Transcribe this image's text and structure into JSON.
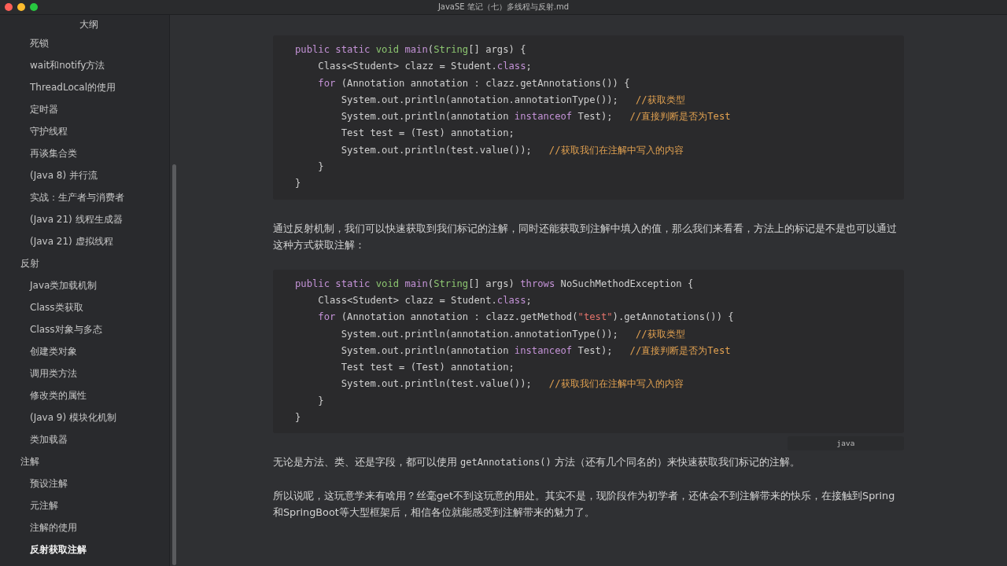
{
  "window": {
    "title": "JavaSE 笔记（七）多线程与反射.md"
  },
  "outline": {
    "title": "大纲",
    "items": [
      {
        "children": [
          {
            "label": "死锁",
            "selected": false
          },
          {
            "label": "wait和notify方法",
            "selected": false
          },
          {
            "label": "ThreadLocal的使用",
            "selected": false
          },
          {
            "label": "定时器",
            "selected": false
          },
          {
            "label": "守护线程",
            "selected": false
          },
          {
            "label": "再谈集合类",
            "selected": false
          },
          {
            "label": "(Java 8) 并行流",
            "selected": false
          },
          {
            "label": "实战：生产者与消费者",
            "selected": false
          },
          {
            "label": "(Java 21) 线程生成器",
            "selected": false
          },
          {
            "label": "(Java 21) 虚拟线程",
            "selected": false
          }
        ]
      },
      {
        "label": "反射",
        "selected": false,
        "children": [
          {
            "label": "Java类加载机制",
            "selected": false
          },
          {
            "label": "Class类获取",
            "selected": false
          },
          {
            "label": "Class对象与多态",
            "selected": false
          },
          {
            "label": "创建类对象",
            "selected": false
          },
          {
            "label": "调用类方法",
            "selected": false
          },
          {
            "label": "修改类的属性",
            "selected": false
          },
          {
            "label": "(Java 9) 模块化机制",
            "selected": false
          },
          {
            "label": "类加载器",
            "selected": false
          }
        ]
      },
      {
        "label": "注解",
        "selected": false,
        "children": [
          {
            "label": "预设注解",
            "selected": false
          },
          {
            "label": "元注解",
            "selected": false
          },
          {
            "label": "注解的使用",
            "selected": false
          },
          {
            "label": "反射获取注解",
            "selected": true
          }
        ]
      }
    ]
  },
  "content": [
    {
      "kind": "code",
      "lines": [
        [
          {
            "t": "public static ",
            "kind": "keyword"
          },
          {
            "t": "void ",
            "kind": "type"
          },
          {
            "t": "main",
            "kind": "def"
          },
          {
            "t": "(",
            "kind": "plain"
          },
          {
            "t": "String",
            "kind": "type"
          },
          {
            "t": "[] args) {",
            "kind": "plain"
          }
        ],
        [
          {
            "t": "    Class<Student> clazz = Student.",
            "kind": "plain"
          },
          {
            "t": "class",
            "kind": "keyword"
          },
          {
            "t": ";",
            "kind": "plain"
          }
        ],
        [
          {
            "t": "    for",
            "kind": "keyword"
          },
          {
            "t": " (Annotation annotation : clazz.getAnnotations()) {",
            "kind": "plain"
          }
        ],
        [
          {
            "t": "        System.out.println(annotation.annotationType());   ",
            "kind": "plain"
          },
          {
            "t": "//获取类型",
            "kind": "comment"
          }
        ],
        [
          {
            "t": "        System.out.println(annotation ",
            "kind": "plain"
          },
          {
            "t": "instanceof",
            "kind": "keyword"
          },
          {
            "t": " Test);   ",
            "kind": "plain"
          },
          {
            "t": "//直接判断是否为Test",
            "kind": "comment"
          }
        ],
        [
          {
            "t": "        Test test = (Test) annotation;",
            "kind": "plain"
          }
        ],
        [
          {
            "t": "        System.out.println(test.value());   ",
            "kind": "plain"
          },
          {
            "t": "//获取我们在注解中写入的内容",
            "kind": "comment"
          }
        ],
        [
          {
            "t": "    }",
            "kind": "plain"
          }
        ],
        [
          {
            "t": "}",
            "kind": "plain"
          }
        ]
      ]
    },
    {
      "kind": "text",
      "parts": [
        {
          "t": "通过反射机制，我们可以快速获取到我们标记的注解，同时还能获取到注解中填入的值，那么我们来看看，方法上的标记是不是也可以通过这种方式获取注解：",
          "kind": "plain"
        }
      ]
    },
    {
      "kind": "code",
      "lang": "java",
      "lines": [
        [
          {
            "t": "public static ",
            "kind": "keyword"
          },
          {
            "t": "void ",
            "kind": "type"
          },
          {
            "t": "main",
            "kind": "def"
          },
          {
            "t": "(",
            "kind": "plain"
          },
          {
            "t": "String",
            "kind": "type"
          },
          {
            "t": "[] args) ",
            "kind": "plain"
          },
          {
            "t": "throws",
            "kind": "keyword"
          },
          {
            "t": " NoSuchMethodException {",
            "kind": "plain"
          }
        ],
        [
          {
            "t": "    Class<Student> clazz = Student.",
            "kind": "plain"
          },
          {
            "t": "class",
            "kind": "keyword"
          },
          {
            "t": ";",
            "kind": "plain"
          }
        ],
        [
          {
            "t": "    for",
            "kind": "keyword"
          },
          {
            "t": " (Annotation annotation : clazz.getMethod(",
            "kind": "plain"
          },
          {
            "t": "\"test\"",
            "kind": "string"
          },
          {
            "t": ").getAnnotations()) {",
            "kind": "plain"
          }
        ],
        [
          {
            "t": "        System.out.println(annotation.annotationType());   ",
            "kind": "plain"
          },
          {
            "t": "//获取类型",
            "kind": "comment"
          }
        ],
        [
          {
            "t": "        System.out.println(annotation ",
            "kind": "plain"
          },
          {
            "t": "instanceof",
            "kind": "keyword"
          },
          {
            "t": " Test);   ",
            "kind": "plain"
          },
          {
            "t": "//直接判断是否为Test",
            "kind": "comment"
          }
        ],
        [
          {
            "t": "        Test test = (Test) annotation;",
            "kind": "plain"
          }
        ],
        [
          {
            "t": "        System.out.println(test.value());   ",
            "kind": "plain"
          },
          {
            "t": "//获取我们在注解中写入的内容",
            "kind": "comment"
          }
        ],
        [
          {
            "t": "    }",
            "kind": "plain"
          }
        ],
        [
          {
            "t": "}",
            "kind": "plain"
          }
        ]
      ]
    },
    {
      "kind": "text",
      "parts": [
        {
          "t": "无论是方法、类、还是字段，都可以使用 ",
          "kind": "plain"
        },
        {
          "t": "getAnnotations()",
          "kind": "code"
        },
        {
          "t": " 方法（还有几个同名的）来快速获取我们标记的注解。",
          "kind": "plain"
        }
      ]
    },
    {
      "kind": "text",
      "parts": [
        {
          "t": "所以说呢，这玩意学来有啥用？丝毫get不到这玩意的用处。其实不是，现阶段作为初学者，还体会不到注解带来的快乐，在接触到Spring和SpringBoot等大型框架后，相信各位就能感受到注解带来的魅力了。",
          "kind": "plain"
        }
      ]
    }
  ]
}
